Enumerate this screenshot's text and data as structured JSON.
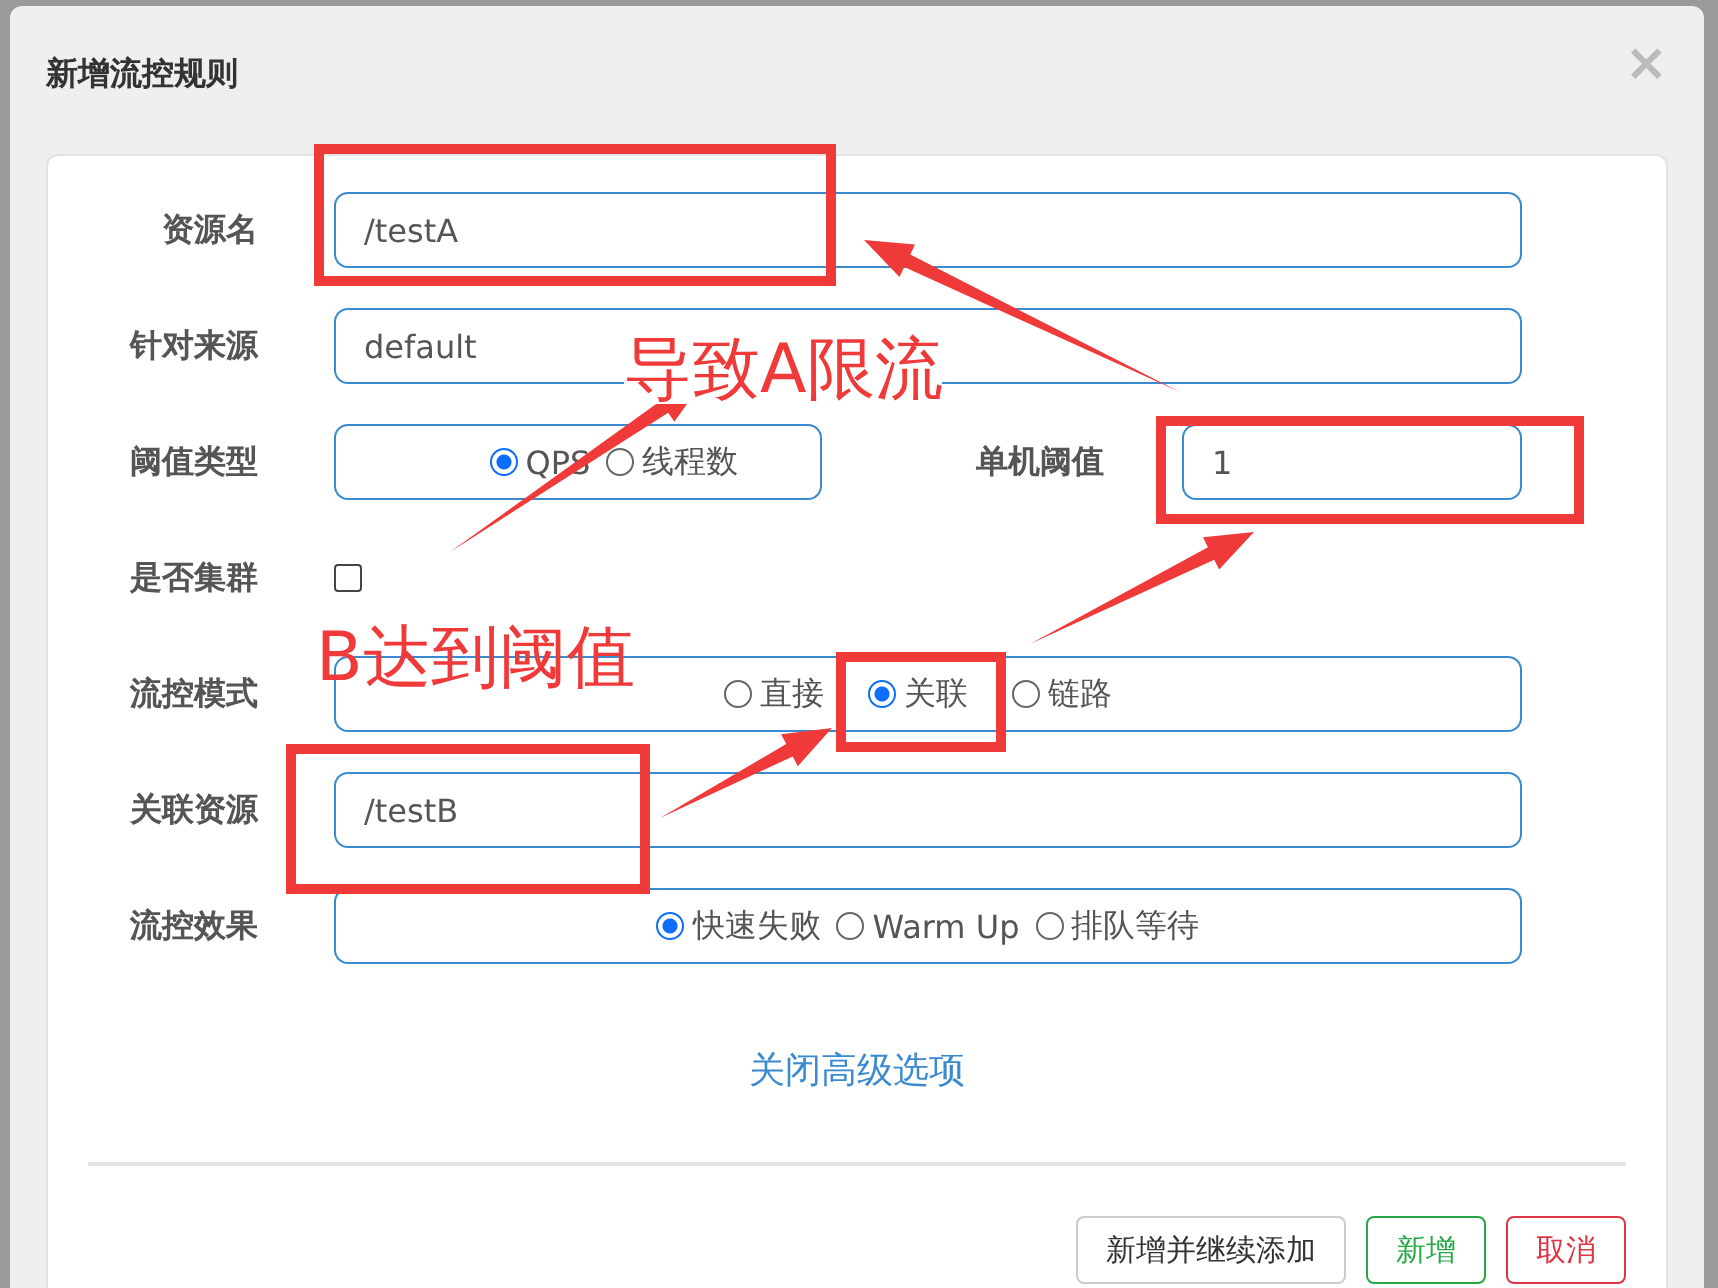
{
  "dialog": {
    "title": "新增流控规则",
    "close": "×"
  },
  "form": {
    "resource": {
      "label": "资源名",
      "value": "/testA"
    },
    "limit_app": {
      "label": "针对来源",
      "value": "default"
    },
    "grade": {
      "label": "阈值类型",
      "options": [
        {
          "label": "QPS",
          "selected": true
        },
        {
          "label": "线程数",
          "selected": false
        }
      ]
    },
    "count": {
      "label": "单机阈值",
      "value": "1"
    },
    "cluster": {
      "label": "是否集群",
      "checked": false
    },
    "strategy": {
      "label": "流控模式",
      "options": [
        {
          "label": "直接",
          "selected": false
        },
        {
          "label": "关联",
          "selected": true
        },
        {
          "label": "链路",
          "selected": false
        }
      ]
    },
    "ref_resource": {
      "label": "关联资源",
      "value": "/testB"
    },
    "control_behavior": {
      "label": "流控效果",
      "options": [
        {
          "label": "快速失败",
          "selected": true
        },
        {
          "label": "Warm Up",
          "selected": false
        },
        {
          "label": "排队等待",
          "selected": false
        }
      ]
    },
    "advanced_link": "关闭高级选项"
  },
  "buttons": [
    {
      "label": "新增并继续添加",
      "kind": "default"
    },
    {
      "label": "新增",
      "kind": "success"
    },
    {
      "label": "取消",
      "kind": "danger"
    }
  ],
  "annotations": [
    {
      "text": "导致A限流"
    },
    {
      "text": "B达到阈值"
    }
  ]
}
